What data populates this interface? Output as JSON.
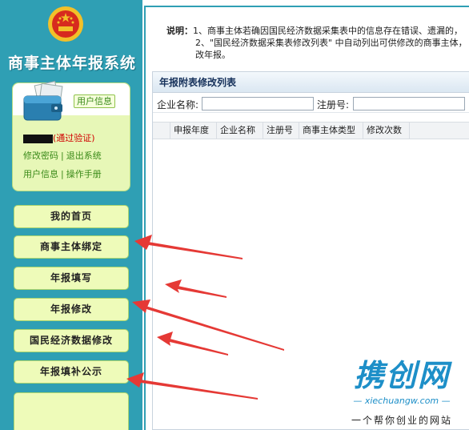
{
  "sidebar": {
    "system_title": "商事主体年报系统",
    "user_panel": {
      "user_info_tag": "用户信息",
      "verify_text": "(通过验证)",
      "link_change_password": "修改密码",
      "separator": "|",
      "link_logout": "退出系统",
      "link_user_info": "用户信息",
      "link_manual": "操作手册"
    },
    "nav": [
      {
        "label": "我的首页"
      },
      {
        "label": "商事主体绑定"
      },
      {
        "label": "年报填写"
      },
      {
        "label": "年报修改"
      },
      {
        "label": "国民经济数据修改"
      },
      {
        "label": "年报填补公示"
      }
    ]
  },
  "main": {
    "notice": {
      "label": "说明：",
      "line1": "1、商事主体若确因国民经济数据采集表中的信息存在错误、遗漏的，",
      "line2": "2、\"国民经济数据采集表修改列表\" 中自动列出可供修改的商事主体，",
      "line3": "改年报。"
    },
    "panel": {
      "title": "年报附表修改列表",
      "search": {
        "company_name_label": "企业名称:",
        "company_name_value": "",
        "reg_no_label": "注册号:",
        "reg_no_value": ""
      },
      "columns": [
        "申报年度",
        "企业名称",
        "注册号",
        "商事主体类型",
        "修改次数"
      ]
    }
  },
  "watermark": {
    "brand": "携创网",
    "url": "— xiechuangw.com —",
    "slogan": "一个帮你创业的网站"
  },
  "colors": {
    "sidebar_bg": "#2f9fb4",
    "button_bg": "#eefbb9",
    "arrow_red": "#e53935",
    "brand_blue": "#1d8fc8"
  }
}
